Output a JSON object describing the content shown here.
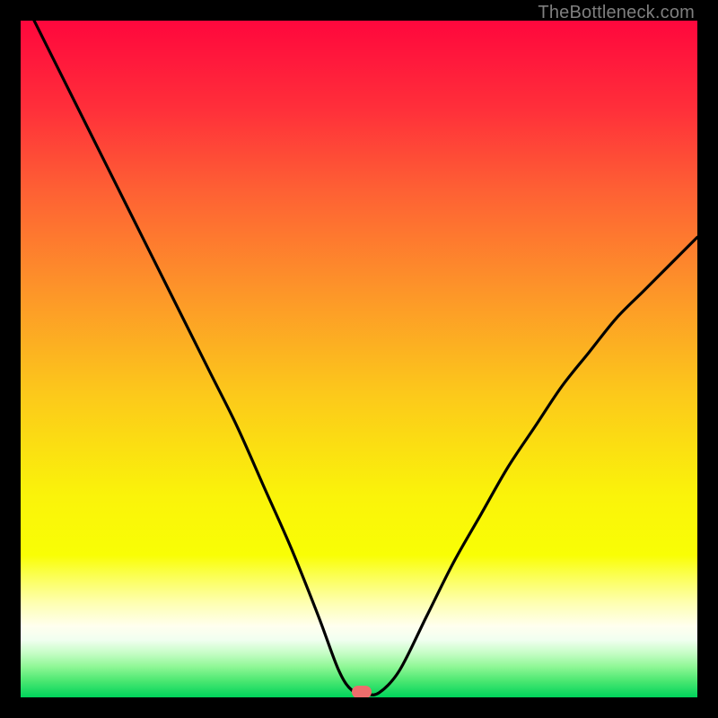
{
  "watermark": "TheBottleneck.com",
  "chart_data": {
    "type": "line",
    "title": "",
    "xlabel": "",
    "ylabel": "",
    "xlim": [
      0,
      100
    ],
    "ylim": [
      0,
      100
    ],
    "grid": false,
    "legend": false,
    "series": [
      {
        "name": "bottleneck-curve",
        "x": [
          0,
          4,
          8,
          12,
          16,
          20,
          24,
          28,
          32,
          36,
          40,
          44,
          47,
          49,
          51,
          53,
          56,
          60,
          64,
          68,
          72,
          76,
          80,
          84,
          88,
          92,
          96,
          100
        ],
        "values": [
          104,
          96,
          88,
          80,
          72,
          64,
          56,
          48,
          40,
          31,
          22,
          12,
          4,
          1,
          0.5,
          0.7,
          4,
          12,
          20,
          27,
          34,
          40,
          46,
          51,
          56,
          60,
          64,
          68
        ]
      }
    ],
    "marker": {
      "x": 50.4,
      "y": 0.8
    },
    "gradient_stops": [
      {
        "pct": 0,
        "color": "#ff073d"
      },
      {
        "pct": 13,
        "color": "#ff2f3a"
      },
      {
        "pct": 25,
        "color": "#fe6034"
      },
      {
        "pct": 40,
        "color": "#fd9529"
      },
      {
        "pct": 55,
        "color": "#fcc81b"
      },
      {
        "pct": 70,
        "color": "#faf30a"
      },
      {
        "pct": 79,
        "color": "#f9fe05"
      },
      {
        "pct": 82,
        "color": "#fbff52"
      },
      {
        "pct": 86,
        "color": "#feffb0"
      },
      {
        "pct": 89.5,
        "color": "#ffffef"
      },
      {
        "pct": 91.5,
        "color": "#f1fff0"
      },
      {
        "pct": 93.5,
        "color": "#c5fdc5"
      },
      {
        "pct": 95.5,
        "color": "#8ef795"
      },
      {
        "pct": 97.5,
        "color": "#4de872"
      },
      {
        "pct": 100,
        "color": "#00d35b"
      }
    ]
  }
}
